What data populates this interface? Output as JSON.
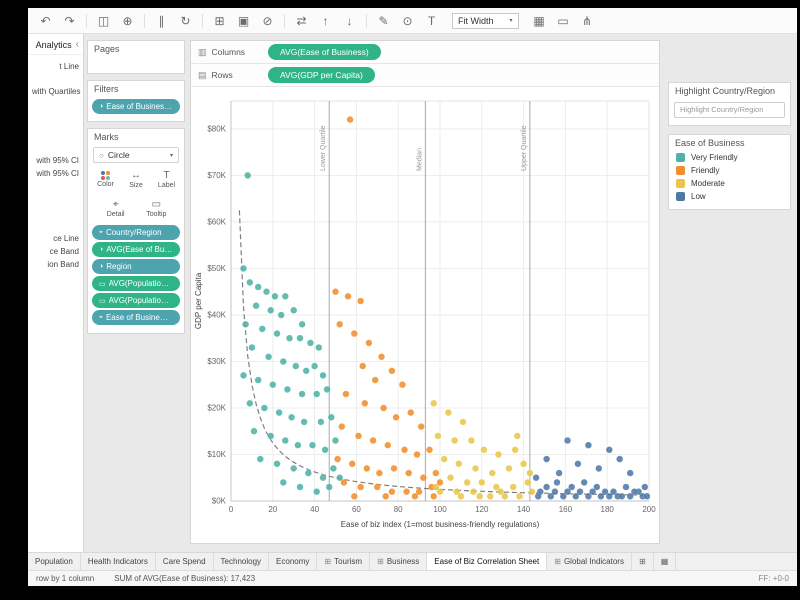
{
  "colors": {
    "dimension_pill": "#4da3ae",
    "measure_pill": "#2fb487"
  },
  "glyphs": {
    "caret": "▾",
    "chevron_left": "‹",
    "columns": "▥",
    "rows": "▤",
    "mark_shape": "○",
    "dashboard_tab": "⊞"
  },
  "toolbar": {
    "left_icons": [
      {
        "name": "undo-icon",
        "glyph": "↶"
      },
      {
        "name": "redo-icon",
        "glyph": "↷"
      },
      {
        "name": "sep"
      },
      {
        "name": "save-icon",
        "glyph": "◫"
      },
      {
        "name": "add-data-icon",
        "glyph": "⊕"
      },
      {
        "name": "sep"
      },
      {
        "name": "pause-updates-icon",
        "glyph": "∥"
      },
      {
        "name": "run-update-icon",
        "glyph": "↻"
      },
      {
        "name": "sep"
      },
      {
        "name": "new-worksheet-icon",
        "glyph": "⊞"
      },
      {
        "name": "duplicate-icon",
        "glyph": "▣"
      },
      {
        "name": "clear-sheet-icon",
        "glyph": "⊘"
      },
      {
        "name": "sep"
      },
      {
        "name": "swap-axes-icon",
        "glyph": "⇄"
      },
      {
        "name": "sort-ascending-icon",
        "glyph": "↑"
      },
      {
        "name": "sort-descending-icon",
        "glyph": "↓"
      },
      {
        "name": "sep"
      },
      {
        "name": "highlight-icon",
        "glyph": "✎"
      },
      {
        "name": "group-members-icon",
        "glyph": "⊙"
      },
      {
        "name": "show-mark-labels-icon",
        "glyph": "T"
      }
    ],
    "fit_label": "Fit Width",
    "right_icons": [
      {
        "name": "show-cards-icon",
        "glyph": "▦"
      },
      {
        "name": "presentation-mode-icon",
        "glyph": "▭"
      },
      {
        "name": "share-icon",
        "glyph": "⋔"
      }
    ]
  },
  "analytics_panel": {
    "title": "Analytics",
    "items": [
      "t Line",
      "with Quartiles",
      "with 95% CI",
      "with 95% CI",
      "ce Line",
      "ce Band",
      "ion Band"
    ]
  },
  "cards": {
    "pages": {
      "title": "Pages"
    },
    "filters": {
      "title": "Filters",
      "pill": {
        "label": "Ease of Business (cl..",
        "type": "dimension"
      }
    },
    "marks": {
      "title": "Marks",
      "mark_type": "Circle",
      "buttons": [
        {
          "name": "color-button",
          "label": "Color",
          "icon": "color"
        },
        {
          "name": "size-button",
          "label": "Size",
          "glyph": "↔"
        },
        {
          "name": "label-button",
          "label": "Label",
          "glyph": "T"
        },
        {
          "name": "detail-button",
          "label": "Detail",
          "glyph": "⌖"
        },
        {
          "name": "tooltip-button",
          "label": "Tooltip",
          "glyph": "▭"
        }
      ],
      "pills": [
        {
          "label": "Country/Region",
          "type": "dimension",
          "glyph": "⌖"
        },
        {
          "label": "AVG(Ease of Business)",
          "type": "measure",
          "glyph": "◑"
        },
        {
          "label": "Region",
          "type": "dimension",
          "glyph": "◑"
        },
        {
          "label": "AVG(Population (…",
          "type": "measure",
          "glyph": "▭"
        },
        {
          "label": "AVG(Population (…",
          "type": "measure",
          "glyph": "▭"
        },
        {
          "label": "Ease of Busine…",
          "type": "dimension",
          "glyph": "⌖"
        }
      ]
    }
  },
  "shelves": {
    "columns_label": "Columns",
    "columns_pill": "AVG(Ease of Business)",
    "rows_label": "Rows",
    "rows_pill": "AVG(GDP per Capita)"
  },
  "chart_data": {
    "type": "scatter",
    "title": "",
    "xlabel": "Ease of biz index (1=most business-friendly regulations)",
    "ylabel": "GDP per Capita",
    "xlim": [
      0,
      200
    ],
    "ylim": [
      0,
      86
    ],
    "x_ticks": [
      0,
      20,
      40,
      60,
      80,
      100,
      120,
      140,
      160,
      180,
      200
    ],
    "y_ticks": [
      0,
      10,
      20,
      30,
      40,
      50,
      60,
      70,
      80
    ],
    "y_tick_prefix": "$",
    "y_tick_suffix": "K",
    "grid": true,
    "legend_position": "right",
    "reference_lines": [
      {
        "x": 47,
        "label": "Lower Quartile"
      },
      {
        "x": 93,
        "label": "Median"
      },
      {
        "x": 143,
        "label": "Upper Quartile"
      }
    ],
    "trend_line": {
      "type": "power",
      "a": 250,
      "b": -1,
      "style": "dashed"
    },
    "series": [
      {
        "name": "Very Friendly",
        "color": "#4fb2a5",
        "points": [
          [
            8,
            70
          ],
          [
            6,
            50
          ],
          [
            9,
            47
          ],
          [
            13,
            46
          ],
          [
            17,
            45
          ],
          [
            21,
            44
          ],
          [
            26,
            44
          ],
          [
            12,
            42
          ],
          [
            19,
            41
          ],
          [
            24,
            40
          ],
          [
            30,
            41
          ],
          [
            34,
            38
          ],
          [
            7,
            38
          ],
          [
            15,
            37
          ],
          [
            22,
            36
          ],
          [
            28,
            35
          ],
          [
            33,
            35
          ],
          [
            38,
            34
          ],
          [
            42,
            33
          ],
          [
            10,
            33
          ],
          [
            18,
            31
          ],
          [
            25,
            30
          ],
          [
            31,
            29
          ],
          [
            36,
            28
          ],
          [
            40,
            29
          ],
          [
            44,
            27
          ],
          [
            6,
            27
          ],
          [
            13,
            26
          ],
          [
            20,
            25
          ],
          [
            27,
            24
          ],
          [
            34,
            23
          ],
          [
            41,
            23
          ],
          [
            46,
            24
          ],
          [
            9,
            21
          ],
          [
            16,
            20
          ],
          [
            23,
            19
          ],
          [
            29,
            18
          ],
          [
            35,
            17
          ],
          [
            43,
            17
          ],
          [
            48,
            18
          ],
          [
            11,
            15
          ],
          [
            19,
            14
          ],
          [
            26,
            13
          ],
          [
            32,
            12
          ],
          [
            39,
            12
          ],
          [
            45,
            11
          ],
          [
            50,
            13
          ],
          [
            14,
            9
          ],
          [
            22,
            8
          ],
          [
            30,
            7
          ],
          [
            37,
            6
          ],
          [
            44,
            5
          ],
          [
            49,
            7
          ],
          [
            25,
            4
          ],
          [
            33,
            3
          ],
          [
            41,
            2
          ],
          [
            52,
            5
          ],
          [
            47,
            3
          ]
        ]
      },
      {
        "name": "Friendly",
        "color": "#f28e2b",
        "points": [
          [
            57,
            82
          ],
          [
            50,
            45
          ],
          [
            56,
            44
          ],
          [
            62,
            43
          ],
          [
            52,
            38
          ],
          [
            59,
            36
          ],
          [
            66,
            34
          ],
          [
            72,
            31
          ],
          [
            63,
            29
          ],
          [
            77,
            28
          ],
          [
            69,
            26
          ],
          [
            82,
            25
          ],
          [
            55,
            23
          ],
          [
            64,
            21
          ],
          [
            73,
            20
          ],
          [
            79,
            18
          ],
          [
            86,
            19
          ],
          [
            91,
            16
          ],
          [
            53,
            16
          ],
          [
            61,
            14
          ],
          [
            68,
            13
          ],
          [
            75,
            12
          ],
          [
            83,
            11
          ],
          [
            89,
            10
          ],
          [
            95,
            11
          ],
          [
            51,
            9
          ],
          [
            58,
            8
          ],
          [
            65,
            7
          ],
          [
            71,
            6
          ],
          [
            78,
            7
          ],
          [
            85,
            6
          ],
          [
            92,
            5
          ],
          [
            98,
            6
          ],
          [
            54,
            4
          ],
          [
            62,
            3
          ],
          [
            70,
            3
          ],
          [
            77,
            2
          ],
          [
            84,
            2
          ],
          [
            90,
            2
          ],
          [
            96,
            3
          ],
          [
            100,
            4
          ],
          [
            59,
            1
          ],
          [
            74,
            1
          ],
          [
            88,
            1
          ],
          [
            97,
            1
          ]
        ]
      },
      {
        "name": "Moderate",
        "color": "#e8c64a",
        "points": [
          [
            97,
            21
          ],
          [
            104,
            19
          ],
          [
            111,
            17
          ],
          [
            99,
            14
          ],
          [
            107,
            13
          ],
          [
            115,
            13
          ],
          [
            121,
            11
          ],
          [
            128,
            10
          ],
          [
            136,
            11
          ],
          [
            102,
            9
          ],
          [
            109,
            8
          ],
          [
            117,
            7
          ],
          [
            125,
            6
          ],
          [
            133,
            7
          ],
          [
            140,
            8
          ],
          [
            105,
            5
          ],
          [
            113,
            4
          ],
          [
            120,
            4
          ],
          [
            127,
            3
          ],
          [
            135,
            3
          ],
          [
            142,
            4
          ],
          [
            100,
            2
          ],
          [
            108,
            2
          ],
          [
            116,
            2
          ],
          [
            124,
            1
          ],
          [
            131,
            1
          ],
          [
            138,
            1
          ],
          [
            144,
            2
          ],
          [
            110,
            1
          ],
          [
            119,
            1
          ],
          [
            129,
            2
          ],
          [
            143,
            6
          ],
          [
            98,
            3
          ],
          [
            137,
            14
          ]
        ]
      },
      {
        "name": "Low",
        "color": "#4e79a7",
        "points": [
          [
            161,
            13
          ],
          [
            171,
            12
          ],
          [
            181,
            11
          ],
          [
            151,
            9
          ],
          [
            166,
            8
          ],
          [
            176,
            7
          ],
          [
            186,
            9
          ],
          [
            191,
            6
          ],
          [
            146,
            5
          ],
          [
            156,
            4
          ],
          [
            163,
            3
          ],
          [
            169,
            4
          ],
          [
            175,
            3
          ],
          [
            183,
            2
          ],
          [
            189,
            3
          ],
          [
            195,
            2
          ],
          [
            148,
            2
          ],
          [
            153,
            1
          ],
          [
            159,
            1
          ],
          [
            165,
            1
          ],
          [
            171,
            1
          ],
          [
            177,
            1
          ],
          [
            181,
            1
          ],
          [
            185,
            1
          ],
          [
            191,
            1
          ],
          [
            197,
            1
          ],
          [
            155,
            2
          ],
          [
            167,
            2
          ],
          [
            173,
            2
          ],
          [
            179,
            2
          ],
          [
            187,
            1
          ],
          [
            193,
            2
          ],
          [
            199,
            1
          ],
          [
            147,
            1
          ],
          [
            151,
            3
          ],
          [
            161,
            2
          ],
          [
            157,
            6
          ],
          [
            198,
            3
          ]
        ]
      }
    ]
  },
  "right_panel": {
    "highlight": {
      "title": "Highlight Country/Region",
      "placeholder": "Highlight Country/Region"
    },
    "legend": {
      "title": "Ease of Business",
      "items": [
        {
          "label": "Very Friendly",
          "color": "#4fb2a5"
        },
        {
          "label": "Friendly",
          "color": "#f28e2b"
        },
        {
          "label": "Moderate",
          "color": "#e8c64a"
        },
        {
          "label": "Low",
          "color": "#4e79a7"
        }
      ]
    }
  },
  "sheet_tabs": {
    "tabs": [
      {
        "label": "Population"
      },
      {
        "label": "Health Indicators"
      },
      {
        "label": "Care Spend"
      },
      {
        "label": "Technology"
      },
      {
        "label": "Economy"
      },
      {
        "label": "Tourism",
        "icon": "dashboard"
      },
      {
        "label": "Business",
        "icon": "dashboard"
      },
      {
        "label": "Ease of Biz Correlation Sheet",
        "active": true
      },
      {
        "label": "Global Indicators",
        "icon": "dashboard"
      }
    ],
    "new_icons": [
      {
        "name": "new-worksheet-tab-icon",
        "glyph": "⊞"
      },
      {
        "name": "new-dashboard-tab-icon",
        "glyph": "▦"
      }
    ]
  },
  "status_bar": {
    "left": "row by 1 column",
    "summary": "SUM of AVG(Ease of Business): 17,423",
    "frame": "FF: +0-0"
  }
}
